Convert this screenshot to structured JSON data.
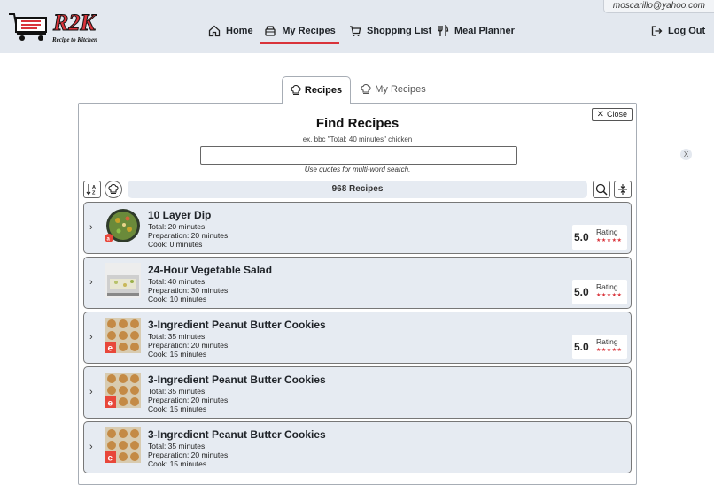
{
  "header": {
    "user_email": "moscarillo@yahoo.com",
    "logo_text": "R2K",
    "logo_tagline": "Recipe to Kitchen",
    "nav": [
      {
        "label": "Home",
        "icon": "home-icon"
      },
      {
        "label": "My Recipes",
        "icon": "recipe-box-icon",
        "active": true
      },
      {
        "label": "Shopping List",
        "icon": "cart-icon"
      },
      {
        "label": "Meal Planner",
        "icon": "utensils-icon"
      }
    ],
    "logout_label": "Log Out"
  },
  "tabs": [
    {
      "label": "Recipes",
      "icon": "chef-hat-icon",
      "active": true
    },
    {
      "label": "My Recipes",
      "icon": "chef-hat-icon",
      "active": false
    }
  ],
  "finder": {
    "close_label": "Close",
    "title": "Find Recipes",
    "hint": "ex. bbc \"Total: 40 minutes\" chicken",
    "search_value": "",
    "search_hint": "Use quotes for multi-word search.",
    "count_label": "968 Recipes"
  },
  "side_close_label": "X",
  "recipes": [
    {
      "title": "10 Layer Dip",
      "total": "Total: 20 minutes",
      "prep": "Preparation: 20 minutes",
      "cook": "Cook: 0 minutes",
      "rating": "5.0",
      "rating_label": "Rating",
      "stars": 5,
      "thumb": "dip"
    },
    {
      "title": "24-Hour Vegetable Salad",
      "total": "Total: 40 minutes",
      "prep": "Preparation: 30 minutes",
      "cook": "Cook: 10 minutes",
      "rating": "5.0",
      "rating_label": "Rating",
      "stars": 5,
      "thumb": "salad"
    },
    {
      "title": "3-Ingredient Peanut Butter Cookies",
      "total": "Total: 35 minutes",
      "prep": "Preparation: 20 minutes",
      "cook": "Cook: 15 minutes",
      "rating": "5.0",
      "rating_label": "Rating",
      "stars": 5,
      "thumb": "cookies"
    },
    {
      "title": "3-Ingredient Peanut Butter Cookies",
      "total": "Total: 35 minutes",
      "prep": "Preparation: 20 minutes",
      "cook": "Cook: 15 minutes",
      "rating": null,
      "thumb": "cookies"
    },
    {
      "title": "3-Ingredient Peanut Butter Cookies",
      "total": "Total: 35 minutes",
      "prep": "Preparation: 20 minutes",
      "cook": "Cook: 15 minutes",
      "rating": null,
      "thumb": "cookies"
    }
  ],
  "colors": {
    "accent": "#d9333a",
    "header_bg": "#e3e8ef",
    "row_bg": "#e6ebf2"
  }
}
